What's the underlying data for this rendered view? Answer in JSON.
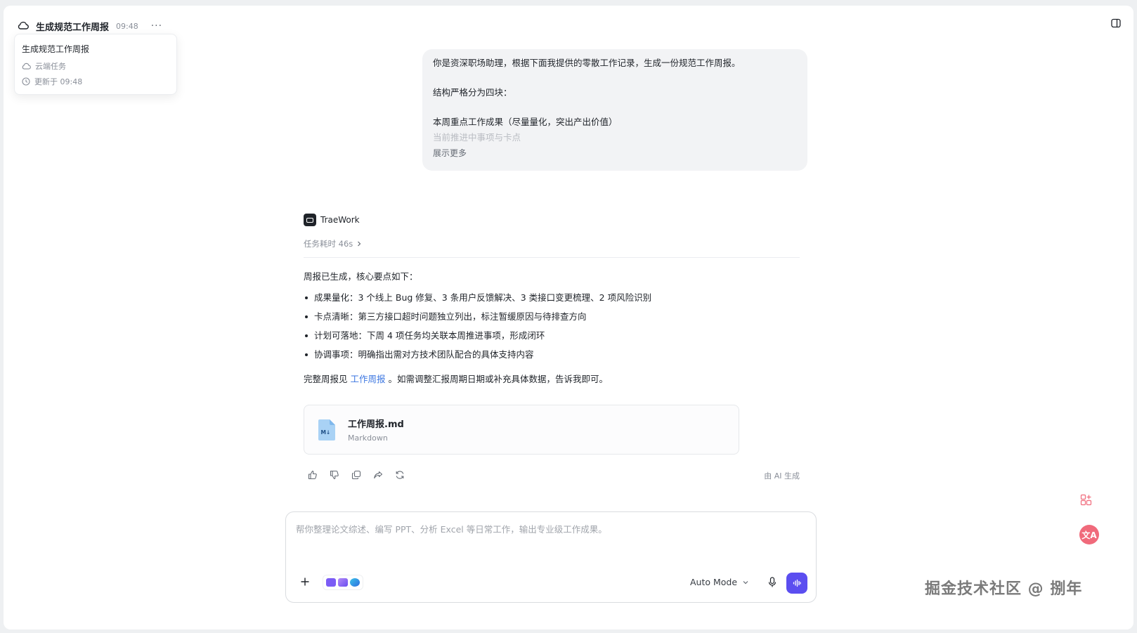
{
  "header": {
    "title": "生成规范工作周报",
    "time": "09:48",
    "more_glyph": "···"
  },
  "popover": {
    "title": "生成规范工作周报",
    "location": "云端任务",
    "updated": "更新于 09:48"
  },
  "user_message": {
    "lines": [
      "你是资深职场助理，根据下面我提供的零散工作记录，生成一份规范工作周报。",
      "结构严格分为四块：",
      "本周重点工作成果（尽量量化，突出产出价值）"
    ],
    "faded_line": "当前推进中事项与卡点",
    "show_more": "展示更多"
  },
  "assistant": {
    "name": "TraeWork",
    "duration": "任务耗时 46s",
    "intro": "周报已生成，核心要点如下：",
    "points": [
      "成果量化：3 个线上 Bug 修复、3 条用户反馈解决、3 类接口变更梳理、2 项风险识别",
      "卡点清晰：第三方接口超时问题独立列出，标注暂缓原因与待排查方向",
      "计划可落地：下周 4 项任务均关联本周推进事项，形成闭环",
      "协调事项：明确指出需对方技术团队配合的具体支持内容"
    ],
    "outro_before": "完整周报见",
    "outro_link": "工作周报",
    "outro_after": "。如需调整汇报周期日期或补充具体数据，告诉我即可。",
    "file": {
      "name": "工作周报.md",
      "type": "Markdown"
    },
    "ai_label": "由 AI 生成"
  },
  "composer": {
    "placeholder": "帮你整理论文综述、编写 PPT、分析 Excel 等日常工作，输出专业级工作成果。",
    "mode": "Auto Mode"
  },
  "float": {
    "translate_glyph": "文A"
  },
  "watermark": "掘金技术社区 @ 捌年",
  "colors": {
    "accent": "#5b4ef0",
    "link": "#3b76e1",
    "translate": "#f06a7b"
  }
}
